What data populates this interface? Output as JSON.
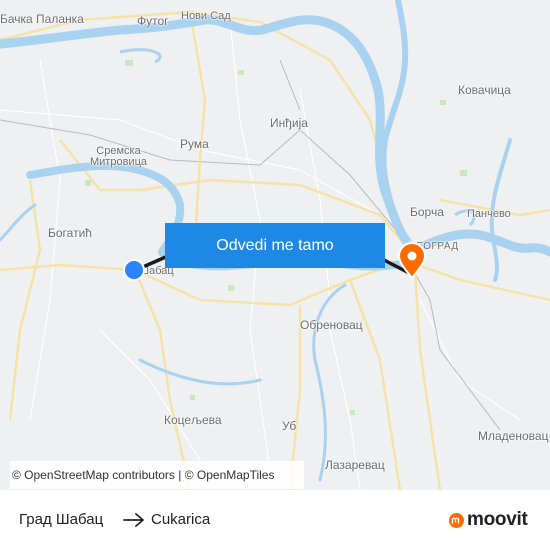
{
  "map": {
    "places": {
      "backa_palanka": "Бачка Паланка",
      "futog": "Футог",
      "novi_sad": "Нови Сад",
      "kovacica": "Ковачица",
      "indjija": "Инђија",
      "ruma": "Рума",
      "sremska_mitrovica": "Сремска\nМитровица",
      "bogatic": "Богатић",
      "sabac": "Шабац",
      "borca": "Борча",
      "pancevo": "Панчево",
      "beograd": "БЕОГРАД",
      "obrenovac": "Обреновац",
      "koceljeva": "Коцељева",
      "ub": "Уб",
      "lazarevac": "Лазаревац",
      "mladenovac": "Младеновац"
    },
    "colors": {
      "land": "#eef0f1",
      "water": "#a8d2f0",
      "road_major": "#f6e2a6",
      "route": "#1a1a1a",
      "origin_dot": "#2b85ff",
      "destination_pin": "#ff6a00"
    },
    "origin_marker_icon": "origin-dot-icon",
    "destination_marker_icon": "map-pin-icon"
  },
  "cta": {
    "label": "Odvedi me tamo",
    "color": "#1e88e5"
  },
  "attribution": {
    "osm": "© OpenStreetMap contributors",
    "separator": " | ",
    "omt": "© OpenMapTiles"
  },
  "footer": {
    "from": "Град Шабац",
    "to": "Cukarica",
    "arrow_icon": "arrow-right-icon",
    "brand": "moovit",
    "brand_icon": "moovit-logo-icon",
    "brand_color": "#ff6a00"
  }
}
